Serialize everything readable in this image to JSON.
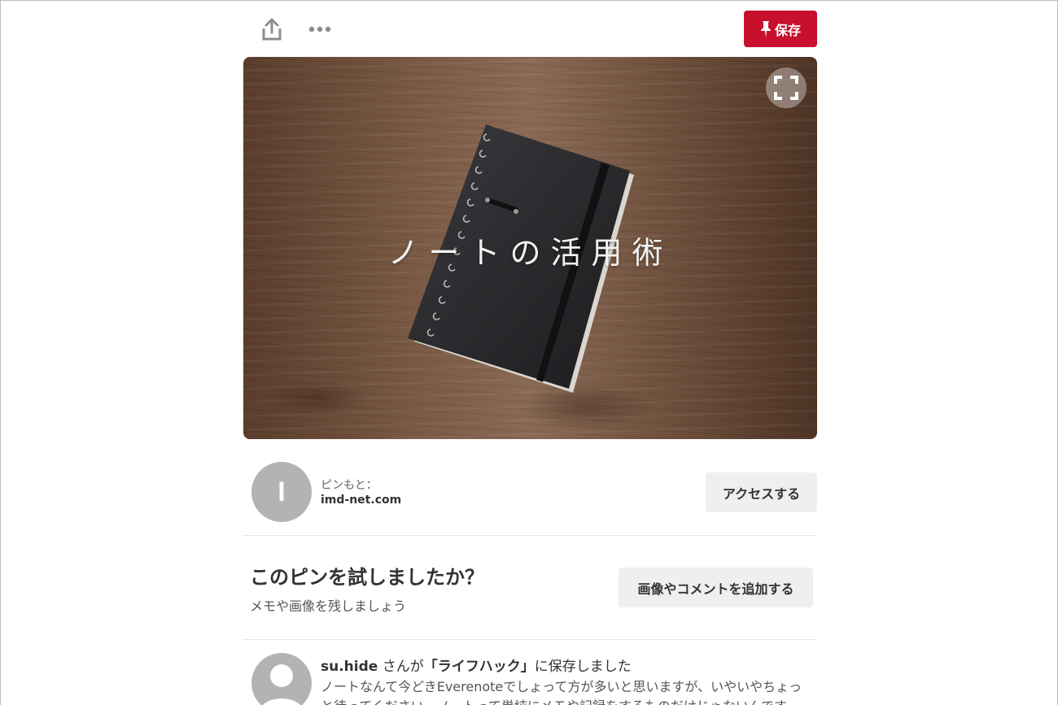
{
  "toolbar": {
    "share_icon": "share-icon",
    "more_icon": "more-dots-icon",
    "save_label": "保存",
    "save_icon": "pin-icon",
    "save_color": "#c8102e"
  },
  "pin": {
    "overlay_text": "ノートの活用術",
    "fullscreen_icon": "fullscreen-icon"
  },
  "source": {
    "avatar_letter": "I",
    "label": "ピンもと：",
    "domain": "imd-net.com",
    "access_label": "アクセスする"
  },
  "tried": {
    "title": "このピンを試しましたか？",
    "subtitle": "メモや画像を残しましょう",
    "add_label": "画像やコメントを追加する"
  },
  "activity": {
    "username": "su.hide",
    "text_mid": " さんが",
    "board": "「ライフハック」",
    "text_end": "に保存しました",
    "description": "ノートなんて今どきEverenoteでしょって方が多いと思いますが、いやいやちょっと待ってください。ノートって単純にメモや記録をするものだけじゃないんです。",
    "avatar_icon": "user-avatar-icon"
  }
}
